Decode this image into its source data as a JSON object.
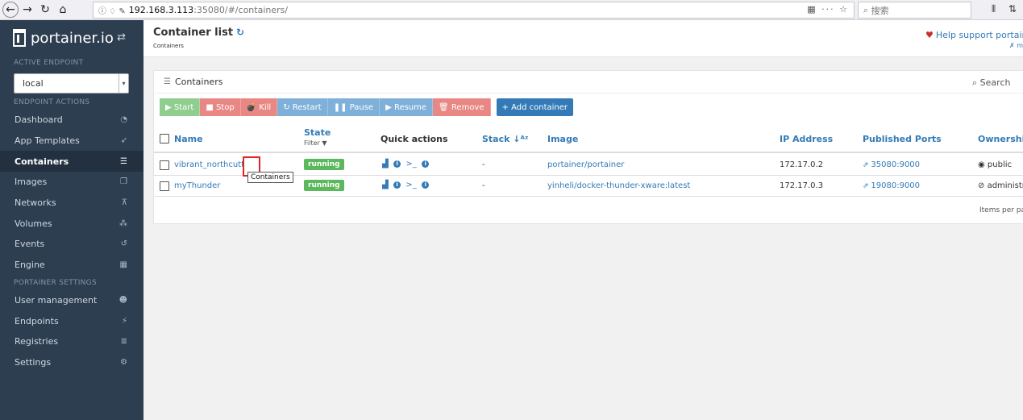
{
  "browser": {
    "url_host": "192.168.3.113",
    "url_rest": ":35080/#/containers/",
    "search_placeholder": "搜索"
  },
  "sidebar": {
    "brand": "portainer.io",
    "active_endpoint_label": "ACTIVE ENDPOINT",
    "endpoint_value": "local",
    "endpoint_actions_label": "ENDPOINT ACTIONS",
    "items": [
      {
        "label": "Dashboard",
        "icon": "tachometer-icon"
      },
      {
        "label": "App Templates",
        "icon": "rocket-icon"
      },
      {
        "label": "Containers",
        "icon": "server-icon"
      },
      {
        "label": "Images",
        "icon": "clone-icon"
      },
      {
        "label": "Networks",
        "icon": "sitemap-icon"
      },
      {
        "label": "Volumes",
        "icon": "cubes-icon"
      },
      {
        "label": "Events",
        "icon": "history-icon"
      },
      {
        "label": "Engine",
        "icon": "th-icon"
      }
    ],
    "portainer_settings_label": "PORTAINER SETTINGS",
    "settings_items": [
      {
        "label": "User management",
        "icon": "users-icon"
      },
      {
        "label": "Endpoints",
        "icon": "plug-icon"
      },
      {
        "label": "Registries",
        "icon": "database-icon"
      },
      {
        "label": "Settings",
        "icon": "cogs-icon"
      }
    ]
  },
  "header": {
    "title": "Container list",
    "breadcrumb": "Containers",
    "help_text": "Help support portaine",
    "help_sub": "✗ m"
  },
  "widget": {
    "title": "Containers",
    "search_label": "Search",
    "actions": {
      "start": "▶ Start",
      "stop": "■ Stop",
      "kill": "💣 Kill",
      "restart": "↻ Restart",
      "pause": "❚❚ Pause",
      "resume": "▶ Resume",
      "remove": "🗑 Remove",
      "add": "+ Add container"
    },
    "columns": {
      "name": "Name",
      "state": "State",
      "state_filter": "Filter ▼",
      "quick_actions": "Quick actions",
      "stack": "Stack ↓ᴬᶻ",
      "image": "Image",
      "ip": "IP Address",
      "ports": "Published Ports",
      "ownership": "Ownership"
    },
    "rows": [
      {
        "name": "vibrant_northcutt",
        "state": "running",
        "stack": "-",
        "image": "portainer/portainer",
        "ip": "172.17.0.2",
        "ports": "35080:9000",
        "ownership": "public"
      },
      {
        "name": "myThunder",
        "state": "running",
        "stack": "-",
        "image": "yinheli/docker-thunder-xware:latest",
        "ip": "172.17.0.3",
        "ports": "19080:9000",
        "ownership": "administra"
      }
    ],
    "tooltip": "Containers",
    "items_per_page": "Items per page"
  }
}
